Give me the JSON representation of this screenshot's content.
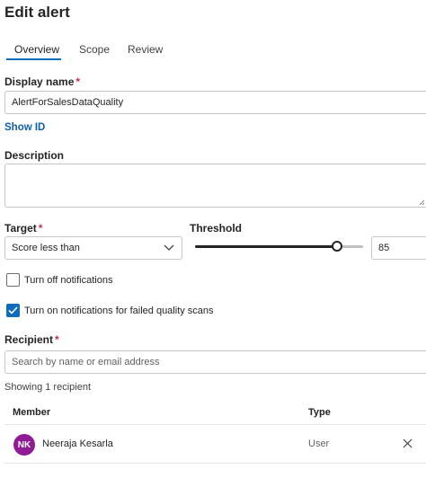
{
  "header": {
    "title": "Edit alert"
  },
  "tabs": [
    {
      "label": "Overview",
      "active": true
    },
    {
      "label": "Scope",
      "active": false
    },
    {
      "label": "Review",
      "active": false
    }
  ],
  "display_name": {
    "label": "Display name",
    "required_mark": "*",
    "value": "AlertForSalesDataQuality"
  },
  "show_id": {
    "label": "Show ID"
  },
  "description": {
    "label": "Description",
    "value": ""
  },
  "target": {
    "label": "Target",
    "required_mark": "*",
    "selected": "Score less than"
  },
  "threshold": {
    "label": "Threshold",
    "value": "85",
    "slider_level_percent": 85
  },
  "notifications": {
    "turn_off": {
      "label": "Turn off notifications",
      "checked": false
    },
    "failed_scans": {
      "label": "Turn on notifications for failed quality scans",
      "checked": true
    }
  },
  "recipient": {
    "label": "Recipient",
    "required_mark": "*",
    "placeholder": "Search by name or email address",
    "count_text": "Showing 1 recipient"
  },
  "table": {
    "headers": {
      "member": "Member",
      "type": "Type"
    },
    "rows": [
      {
        "initials": "NK",
        "name": "Neeraja Kesarla",
        "type": "User"
      }
    ]
  },
  "colors": {
    "accent": "#0f6cbd",
    "avatar": "#8f1c95",
    "required": "#c4314b"
  }
}
